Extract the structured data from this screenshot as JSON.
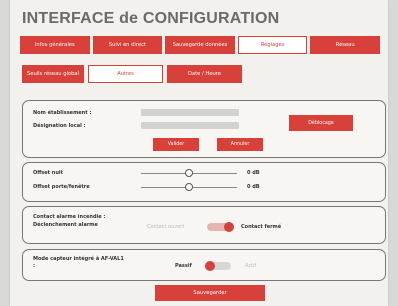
{
  "page": {
    "title": "INTERFACE de CONFIGURATION"
  },
  "tabs": [
    {
      "label": "Infos générales",
      "active": false
    },
    {
      "label": "Suivi en direct",
      "active": false
    },
    {
      "label": "Sauvegarde données",
      "active": false
    },
    {
      "label": "Réglages",
      "active": true
    },
    {
      "label": "Réseau",
      "active": false
    }
  ],
  "subtabs": [
    {
      "label": "Seuils réseau global",
      "active": false
    },
    {
      "label": "Autres",
      "active": true
    },
    {
      "label": "Date / Heure",
      "active": false
    }
  ],
  "establishment": {
    "name_label": "Nom établissement :",
    "name_value": "",
    "local_label": "Désignation local :",
    "local_value": "",
    "validate_label": "Valider",
    "cancel_label": "Annuler",
    "unlock_label": "Déblocage"
  },
  "offsets": {
    "night_label": "Offset nuit",
    "night_value": "0 dB",
    "night_level": 0.5,
    "door_label": "Offset porte/fenêtre",
    "door_value": "0 dB",
    "door_level": 0.5
  },
  "fire_alarm": {
    "label_line1": "Contact alarme incendie :",
    "label_line2": "Déclenchement alarme",
    "option_open": "Contact ouvert",
    "option_closed": "Contact fermé",
    "selected": "Contact fermé"
  },
  "sensor_mode": {
    "label_line1": "Mode capteur intégré à AF-VAL1",
    "label_line2": ":",
    "option_passive": "Passif",
    "option_active": "Actif",
    "selected": "Passif"
  },
  "footer": {
    "save_label": "Sauvegarder"
  },
  "colors": {
    "accent": "#d8403a",
    "background": "#f2f1ee"
  }
}
